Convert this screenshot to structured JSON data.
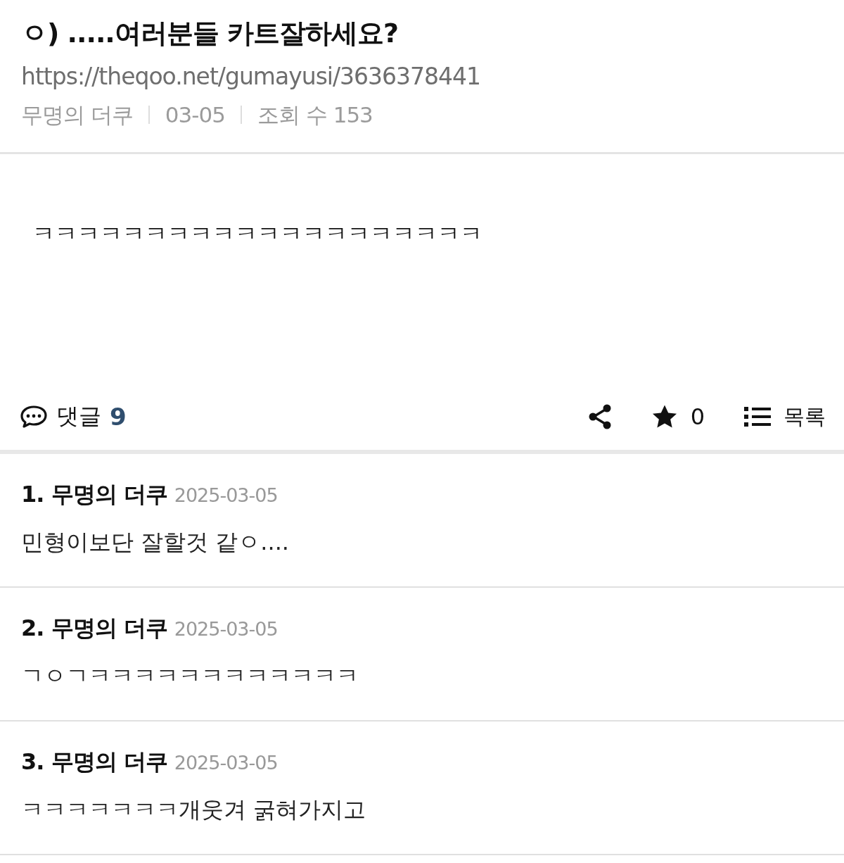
{
  "post": {
    "title": "ㅇ) .....여러분들 카트잘하세요?",
    "url": "https://theqoo.net/gumayusi/3636378441",
    "author": "무명의 더쿠",
    "date": "03-05",
    "views": "조회 수 153",
    "body": "ㅋㅋㅋㅋㅋㅋㅋㅋㅋㅋㅋㅋㅋㅋㅋㅋㅋㅋㅋㅋ"
  },
  "actions": {
    "comments_label": "댓글",
    "comments_count": "9",
    "stars": "0",
    "list_label": "목록"
  },
  "comments": [
    {
      "number": "1.",
      "author": "무명의 더쿠",
      "date": "2025-03-05",
      "text": "민형이보단 잘할것 같ㅇ...."
    },
    {
      "number": "2.",
      "author": "무명의 더쿠",
      "date": "2025-03-05",
      "text": "ㄱㅇㄱㅋㅋㅋㅋㅋㅋㅋㅋㅋㅋㅋㅋ"
    },
    {
      "number": "3.",
      "author": "무명의 더쿠",
      "date": "2025-03-05",
      "text": "ㅋㅋㅋㅋㅋㅋㅋ개웃겨 굵혀가지고"
    }
  ]
}
